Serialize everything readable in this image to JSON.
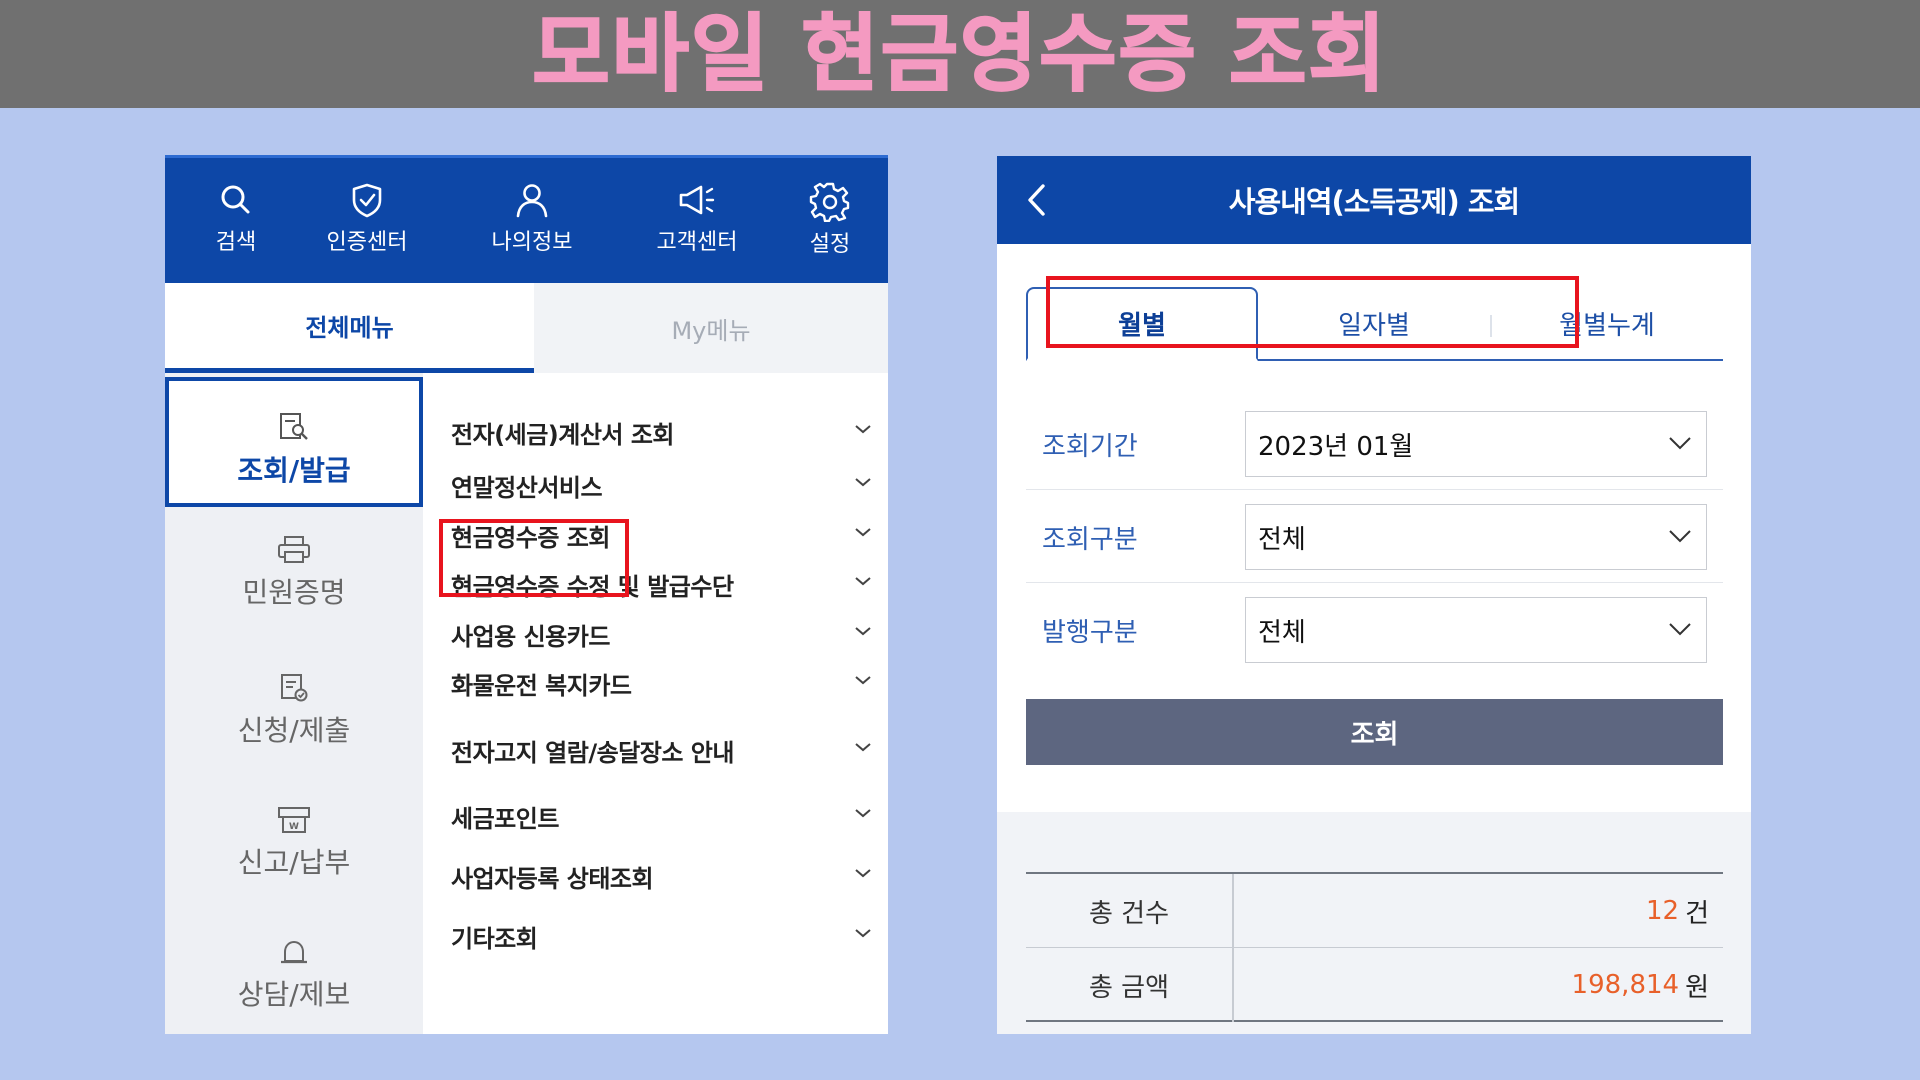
{
  "banner": {
    "title": "모바일 현금영수증 조회"
  },
  "left": {
    "top_buttons": [
      {
        "icon": "search-icon",
        "label": "검색"
      },
      {
        "icon": "shield-check-icon",
        "label": "인증센터"
      },
      {
        "icon": "user-icon",
        "label": "나의정보"
      },
      {
        "icon": "megaphone-icon",
        "label": "고객센터"
      },
      {
        "icon": "gear-icon",
        "label": "설정"
      }
    ],
    "tabs": {
      "all": "전체메뉴",
      "my": "My메뉴",
      "active": "전체메뉴"
    },
    "side_items": [
      {
        "icon": "document-search-icon",
        "label": "조회/발급",
        "active": true
      },
      {
        "icon": "printer-icon",
        "label": "민원증명",
        "active": false
      },
      {
        "icon": "document-check-icon",
        "label": "신청/제출",
        "active": false
      },
      {
        "icon": "tax-payment-icon",
        "label": "신고/납부",
        "active": false
      },
      {
        "icon": "bell-icon",
        "label": "상담/제보",
        "active": false
      }
    ],
    "menu_items": [
      "전자(세금)계산서 조회",
      "연말정산서비스",
      "현금영수증 조회",
      "현금영수증 수정 및 발급수단",
      "사업용 신용카드",
      "화물운전 복지카드",
      "전자고지 열람/송달장소 안내",
      "세금포인트",
      "사업자등록 상태조회",
      "기타조회"
    ],
    "highlighted_item": "현금영수증 조회"
  },
  "right": {
    "header": {
      "title": "사용내역(소득공제) 조회",
      "back_icon": "chevron-left-icon"
    },
    "segments": [
      "월별",
      "일자별",
      "월별누계"
    ],
    "active_segment": "월별",
    "filters": [
      {
        "label": "조회기간",
        "value": "2023년 01월"
      },
      {
        "label": "조회구분",
        "value": "전체"
      },
      {
        "label": "발행구분",
        "value": "전체"
      }
    ],
    "query_button": "조회",
    "summary": [
      {
        "label": "총 건수",
        "value": "12",
        "unit": "건"
      },
      {
        "label": "총 금액",
        "value": "198,814",
        "unit": "원"
      }
    ]
  },
  "colors": {
    "brand": "#0d47a7",
    "highlight": "#e8141e",
    "amount": "#e8602a",
    "banner_text": "#f49ac1"
  }
}
